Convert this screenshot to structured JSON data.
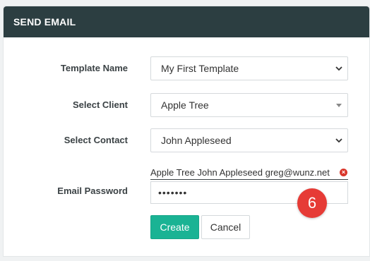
{
  "header": {
    "title": "SEND EMAIL"
  },
  "form": {
    "template_name": {
      "label": "Template Name",
      "value": "My First Template"
    },
    "client": {
      "label": "Select Client",
      "value": "Apple Tree"
    },
    "contact": {
      "label": "Select Contact",
      "value": "John Appleseed"
    },
    "email_password": {
      "label": "Email Password",
      "selected_recipient": "Apple Tree John Appleseed  greg@wunz.net",
      "value": "•••••••"
    }
  },
  "annotation": {
    "step_number": "6"
  },
  "actions": {
    "create_label": "Create",
    "cancel_label": "Cancel"
  },
  "colors": {
    "header_bg": "#2c3e41",
    "primary": "#1ab394",
    "badge": "#e63b36",
    "remove_icon": "#d9362b"
  },
  "icons": {
    "select_chevron": "chevron-down-icon",
    "chip_remove": "close-circle-icon"
  }
}
